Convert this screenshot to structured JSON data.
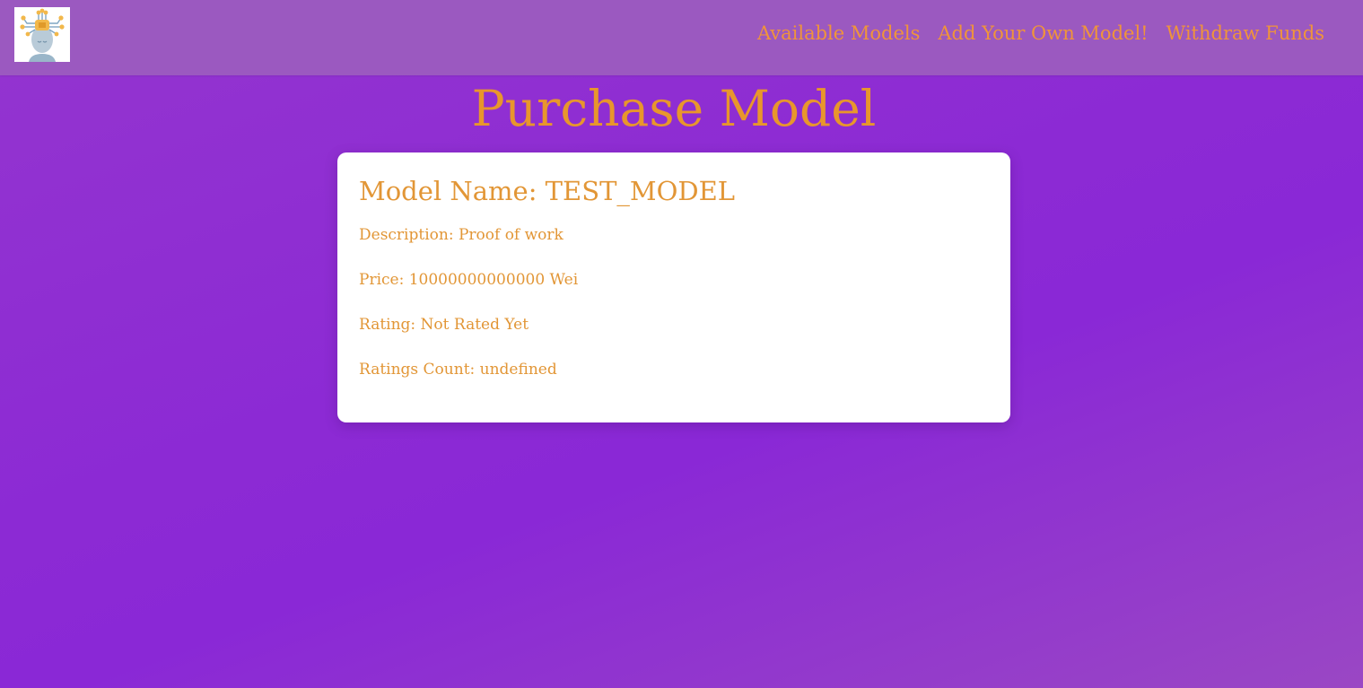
{
  "header": {
    "logo_icon": "ai-head-circuit-icon",
    "nav": [
      {
        "label": "Available Models"
      },
      {
        "label": "Add Your Own Model!"
      },
      {
        "label": "Withdraw Funds"
      }
    ]
  },
  "main": {
    "title": "Purchase Model",
    "card": {
      "model_name": "Model Name: TEST_MODEL",
      "description": "Description: Proof of work",
      "price": "Price: 10000000000000 Wei",
      "rating": "Rating: Not Rated Yet",
      "ratings_count": "Ratings Count: undefined"
    }
  },
  "colors": {
    "accent": "#e8962c",
    "navbar": "#9b59c0",
    "background": "#8c2ad4",
    "card": "#ffffff"
  }
}
